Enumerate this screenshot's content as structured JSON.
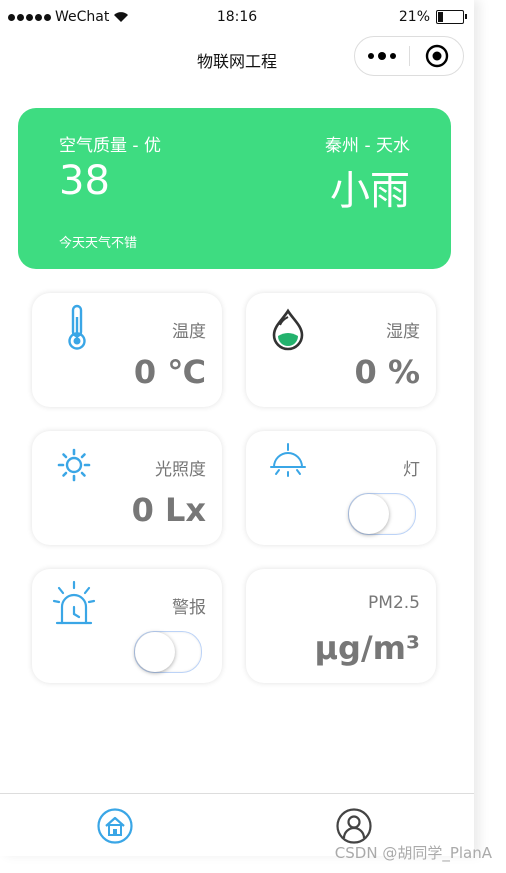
{
  "status_bar": {
    "carrier": "WeChat",
    "time": "18:16",
    "battery": "21%",
    "battery_level": 0.21
  },
  "nav": {
    "title": "物联网工程"
  },
  "weather": {
    "quality_label": "空气质量 - 优",
    "aqi": "38",
    "tip": "今天天气不错",
    "location": "秦州 - 天水",
    "condition": "小雨",
    "color": "#3edc81"
  },
  "cards": {
    "temperature": {
      "label": "温度",
      "value": "0 ℃",
      "icon": "thermometer-icon"
    },
    "humidity": {
      "label": "湿度",
      "value": "0 %",
      "icon": "water-drop-icon"
    },
    "light": {
      "label": "光照度",
      "value": "0 Lx",
      "icon": "sun-icon"
    },
    "lamp": {
      "label": "灯",
      "icon": "lamp-icon",
      "switch_on": false
    },
    "alarm": {
      "label": "警报",
      "icon": "alarm-light-icon",
      "switch_on": false
    },
    "pm25": {
      "label": "PM2.5",
      "value": "μg/m³"
    }
  },
  "tabbar": {
    "items": [
      {
        "icon": "home-icon"
      },
      {
        "icon": "user-icon"
      }
    ]
  },
  "watermark": "CSDN @胡同学_PlanA"
}
